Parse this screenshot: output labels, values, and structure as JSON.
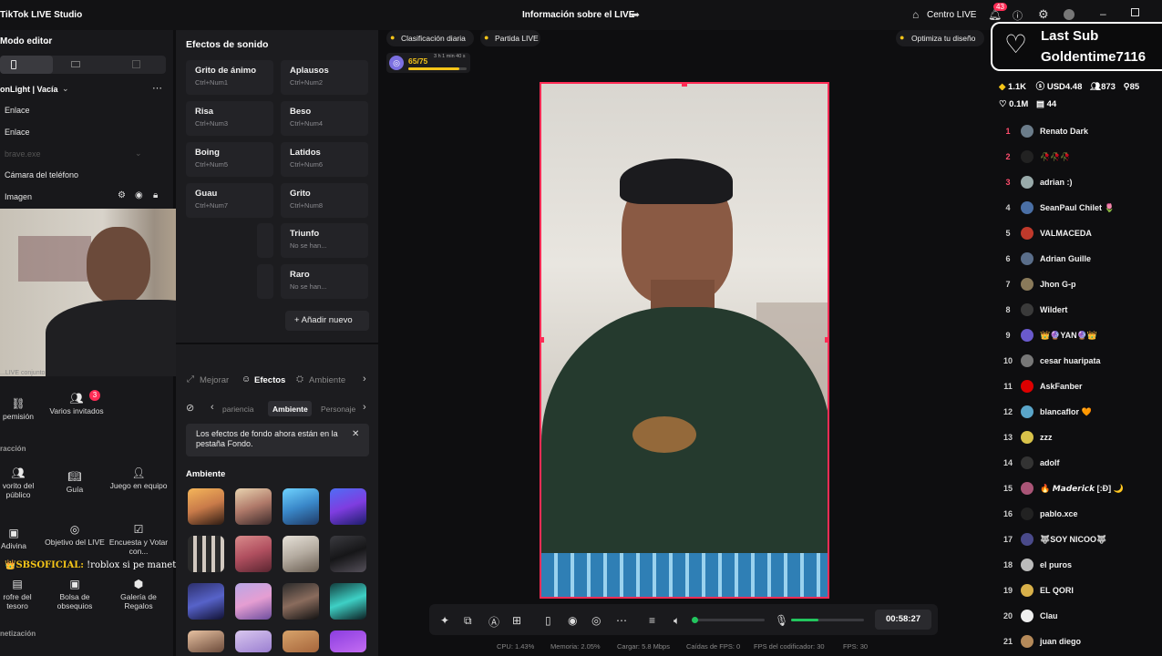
{
  "app": {
    "title": "TikTok LIVE Studio",
    "center_title": "Información sobre el LIVE",
    "live_center": "Centro LIVE",
    "notif_count": "43"
  },
  "left": {
    "mode": "Modo editor",
    "scene": "onLight | Vacía",
    "items": [
      "Enlace",
      "Enlace",
      "brave.exe",
      "Cámara del teléfono",
      "Imagen"
    ],
    "tiles": [
      "pemisión",
      "Varios invitados",
      "racción",
      "vorito del público",
      "Guía",
      "Juego en equipo",
      "Adivina",
      "Objetivo del LIVE",
      "Encuesta y Votar con...",
      "rofre del tesoro",
      "Bolsa de obsequios",
      "Galería de Regalos",
      "netización"
    ],
    "tile_badge": "3",
    "chat_user": "SBSOFICIAL:",
    "chat_msg": "!roblox si pe maneto",
    "cam_label": "...LIVE conjunto"
  },
  "sounds": {
    "title": "Efectos de sonido",
    "items": [
      {
        "n": "Grito de ánimo",
        "k": "Ctrl+Num1"
      },
      {
        "n": "Aplausos",
        "k": "Ctrl+Num2"
      },
      {
        "n": "Risa",
        "k": "Ctrl+Num3"
      },
      {
        "n": "Beso",
        "k": "Ctrl+Num4"
      },
      {
        "n": "Boing",
        "k": "Ctrl+Num5"
      },
      {
        "n": "Latidos",
        "k": "Ctrl+Num6"
      },
      {
        "n": "Guau",
        "k": "Ctrl+Num7"
      },
      {
        "n": "Grito",
        "k": "Ctrl+Num8"
      },
      {
        "n": "Triunfo",
        "k": "No se han..."
      },
      {
        "n": "Raro",
        "k": "No se han..."
      }
    ],
    "add": "Añadir nuevo"
  },
  "effects": {
    "tabs": [
      "Mejorar",
      "Efectos",
      "Ambiente"
    ],
    "sub": [
      "pariencia",
      "Ambiente",
      "Personaje"
    ],
    "notice": "Los efectos de fondo ahora están en la pestaña Fondo.",
    "section": "Ambiente"
  },
  "stage": {
    "rank": "Clasificación diaria",
    "match": "Partida LIVE",
    "design": "Optimiza tu diseño",
    "progress": "65/75",
    "progress_time": "3 h 1 min 40 s",
    "progress_pct": 0.87,
    "timer": "00:58:27"
  },
  "status": {
    "cpu": "CPU: 1.43%",
    "mem": "Memoria: 2.05%",
    "up": "Cargar: 5.8 Mbps",
    "fps_drop": "Caídas de FPS: 0",
    "enc": "FPS del codificador: 30",
    "fps": "FPS: 30"
  },
  "right": {
    "last_sub": "Last Sub",
    "sub_name": "Goldentime7116",
    "likes": "1.1K",
    "usd": "USD4.48",
    "viewers": "873",
    "other": "85",
    "total": "0.1M",
    "hearts": "44",
    "viewers_list": [
      "Renato Dark",
      "🥀🥀🥀",
      "adrian :)",
      "SeanPaul Chilet 🌷",
      "VALMACEDA",
      "Adrian Guille",
      "Jhon G-p",
      "Wildert",
      "👑🔮YAN🔮👑",
      "cesar huaripata",
      "AskFanber",
      "blancaflor 🧡",
      "zzz",
      "adolf",
      "🔥 𝙈𝙖𝙙𝙚𝙧𝙞𝙘𝙠 [:Ð] 🌙",
      "pablo.xce",
      "🐺SOY NICOO🐺",
      "el puros",
      "EL QORI",
      "Clau",
      "juan diego"
    ]
  },
  "colors": {
    "accent": "#fe2c55",
    "bg": "#0e0e10",
    "green": "#22c55e"
  }
}
